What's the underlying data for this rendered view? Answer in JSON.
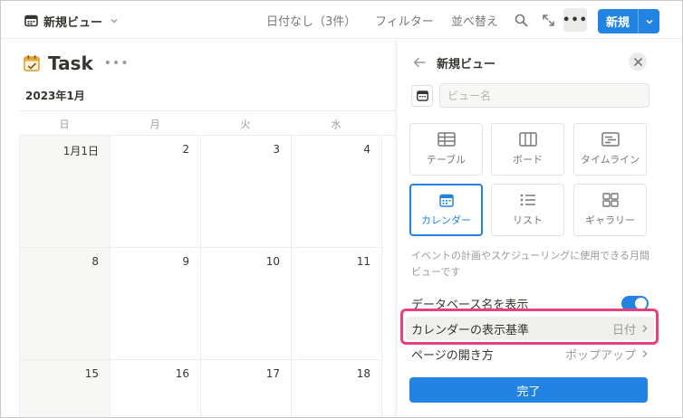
{
  "toolbar": {
    "view_label": "新規ビュー",
    "no_date": "日付なし（3件）",
    "filter": "フィルター",
    "sort": "並べ替え",
    "more": "•••",
    "new_label": "新規"
  },
  "page": {
    "title": "Task",
    "more": "•••",
    "month": "2023年1月"
  },
  "calendar": {
    "weekdays": [
      "日",
      "月",
      "火",
      "水"
    ],
    "rows": [
      [
        "1月1日",
        "2",
        "3",
        "4"
      ],
      [
        "8",
        "9",
        "10",
        "11"
      ],
      [
        "15",
        "16",
        "17",
        "18"
      ]
    ]
  },
  "panel": {
    "title": "新規ビュー",
    "name_placeholder": "ビュー名",
    "layouts": [
      {
        "label": "テーブル",
        "icon": "table-icon",
        "selected": false
      },
      {
        "label": "ボード",
        "icon": "board-icon",
        "selected": false
      },
      {
        "label": "タイムライン",
        "icon": "timeline-icon",
        "selected": false
      },
      {
        "label": "カレンダー",
        "icon": "calendar-icon",
        "selected": true
      },
      {
        "label": "リスト",
        "icon": "list-icon",
        "selected": false
      },
      {
        "label": "ギャラリー",
        "icon": "gallery-icon",
        "selected": false
      }
    ],
    "description": "イベントの計画やスケジューリングに使用できる月間ビューです",
    "show_db_name": {
      "label": "データベース名を表示",
      "enabled": true
    },
    "calendar_by": {
      "label": "カレンダーの表示基準",
      "value": "日付"
    },
    "open_pages": {
      "label": "ページの開き方",
      "value": "ポップアップ"
    },
    "done": "完了"
  },
  "colors": {
    "accent": "#2383e2",
    "highlight": "#e8407e",
    "text": "#37352f",
    "muted": "#9b9a97"
  }
}
